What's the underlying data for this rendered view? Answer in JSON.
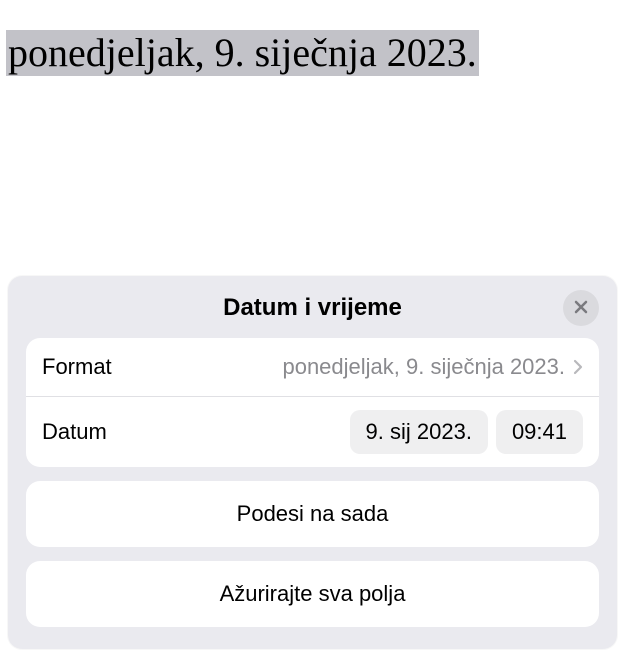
{
  "document": {
    "selectedText": "ponedjeljak, 9. siječnja 2023."
  },
  "panel": {
    "title": "Datum i vrijeme",
    "rows": {
      "format": {
        "label": "Format",
        "value": "ponedjeljak, 9. siječnja 2023."
      },
      "date": {
        "label": "Datum",
        "dateValue": "9. sij 2023.",
        "timeValue": "09:41"
      }
    },
    "buttons": {
      "setNow": "Podesi na sada",
      "updateAll": "Ažurirajte sva polja"
    }
  }
}
